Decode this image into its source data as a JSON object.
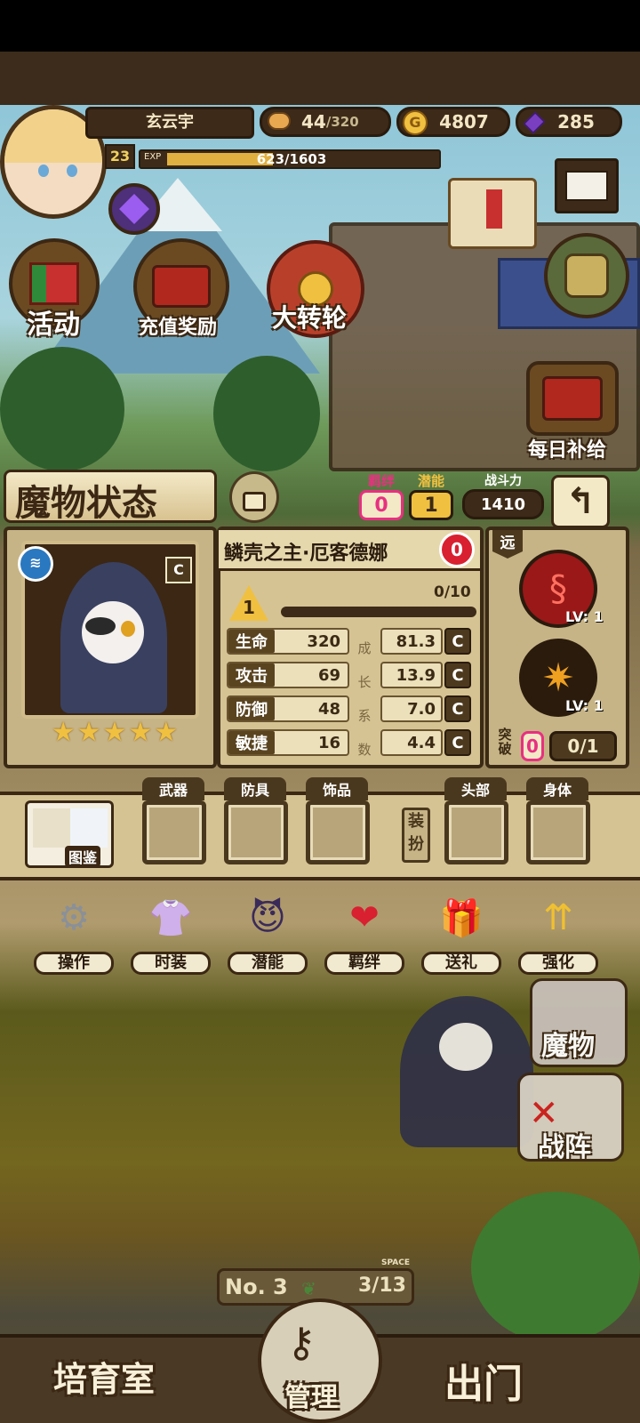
{
  "header": {
    "player_name": "玄云宇",
    "level": "23",
    "exp_label": "EXP",
    "exp_value": "623/1603",
    "exp_fraction": 0.389,
    "stamina": "44",
    "stamina_max": "/320",
    "gold": "4807",
    "gems": "285"
  },
  "town_buttons": {
    "activity": "活动",
    "recharge": "充值奖励",
    "wheel": "大转轮",
    "daily": "每日补给"
  },
  "monster_panel": {
    "title": "魔物状态",
    "bond_label": "羁绊",
    "bond_value": "0",
    "potential_label": "潜能",
    "potential_value": "1",
    "power_label": "战斗力",
    "power_value": "1410",
    "name": "鳞壳之主·厄客德娜",
    "affection": "0",
    "rank_badge": "C",
    "star_level": "1",
    "progress": "0/10",
    "progress_fraction": 0.0,
    "range_tag": "远",
    "stars": 5,
    "stats": [
      {
        "key": "生命",
        "value": "320",
        "growth": "81.3",
        "grade": "C"
      },
      {
        "key": "攻击",
        "value": "69",
        "growth": "13.9",
        "grade": "C"
      },
      {
        "key": "防御",
        "value": "48",
        "growth": "7.0",
        "grade": "C"
      },
      {
        "key": "敏捷",
        "value": "16",
        "growth": "4.4",
        "grade": "C"
      }
    ],
    "growth_vertical": [
      "成",
      "长",
      "系",
      "数"
    ],
    "skills": [
      {
        "level": "LV: 1",
        "icon": "serpent-skill-icon"
      },
      {
        "level": "LV: 1",
        "icon": "burst-skill-icon"
      }
    ],
    "breakthrough_label_1": "突",
    "breakthrough_label_2": "破",
    "breakthrough_value": "0",
    "breakthrough_progress": "0/1"
  },
  "equipment": {
    "codex_label": "图鉴",
    "weapon": "武器",
    "armor": "防具",
    "accessory": "饰品",
    "equip_btn_1": "装",
    "equip_btn_2": "扮",
    "head": "头部",
    "body": "身体"
  },
  "menu": [
    {
      "label": "操作",
      "icon": "gear-icon"
    },
    {
      "label": "时装",
      "icon": "outfit-icon"
    },
    {
      "label": "潜能",
      "icon": "demon-icon"
    },
    {
      "label": "羁绊",
      "icon": "hearts-icon"
    },
    {
      "label": "送礼",
      "icon": "gift-icon"
    },
    {
      "label": "强化",
      "icon": "arrows-up-icon"
    }
  ],
  "side_buttons": {
    "monster": "魔物",
    "formation": "战阵"
  },
  "floor": {
    "number": "No. 3",
    "space_label": "SPACE",
    "space_value": "3/13"
  },
  "bottom_nav": {
    "nursery": "培育室",
    "manage": "管理",
    "depart": "出门"
  },
  "colors": {
    "gold": "#f0c040",
    "gem": "#7a3fc0",
    "panel": "#d9c79a",
    "frame": "#3a2a15"
  }
}
